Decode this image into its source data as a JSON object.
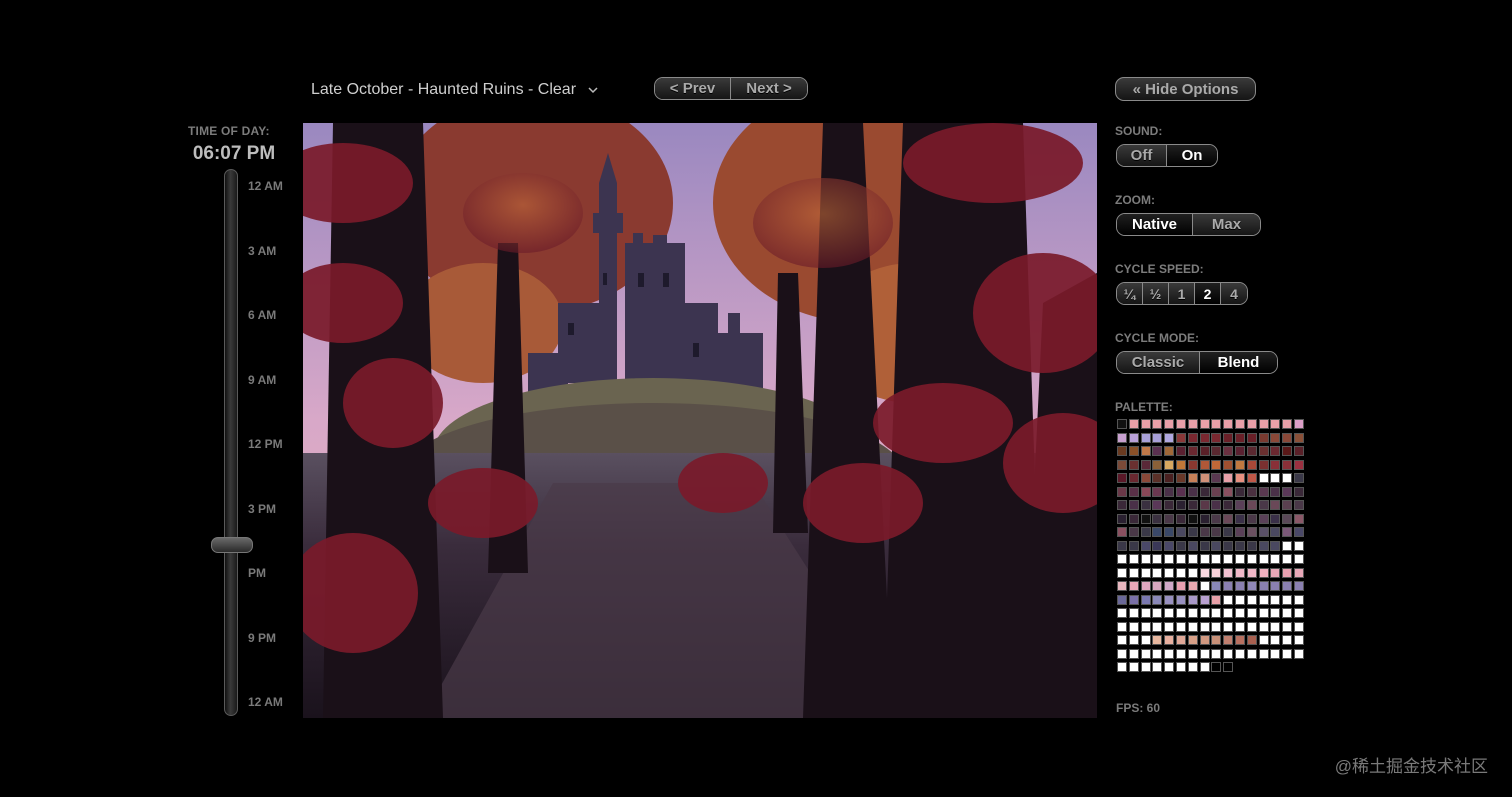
{
  "header": {
    "scene_title": "Late October - Haunted Ruins - Clear",
    "prev_label": "< Prev",
    "next_label": "Next >",
    "hide_options_label": "« Hide Options"
  },
  "time_of_day": {
    "label": "TIME OF DAY:",
    "value": "06:07 PM",
    "ticks": [
      "12 AM",
      "3 AM",
      "6 AM",
      "9 AM",
      "12 PM",
      "3 PM",
      "PM",
      "9 PM",
      "12 AM"
    ],
    "position_fraction": 0.755
  },
  "options": {
    "sound": {
      "label": "SOUND:",
      "choices": [
        "Off",
        "On"
      ],
      "selected": "On"
    },
    "zoom": {
      "label": "ZOOM:",
      "choices": [
        "Native",
        "Max"
      ],
      "selected": "Native"
    },
    "cycle_speed": {
      "label": "CYCLE SPEED:",
      "choices": [
        "¼",
        "½",
        "1",
        "2",
        "4"
      ],
      "selected": "2"
    },
    "cycle_mode": {
      "label": "CYCLE MODE:",
      "choices": [
        "Classic",
        "Blend"
      ],
      "selected": "Blend"
    },
    "palette_label": "PALETTE:",
    "fps": "FPS: 60"
  },
  "palette_colors": [
    "#111111",
    "#e8a0a8",
    "#e8a0a8",
    "#e8a0a8",
    "#e8a0a8",
    "#e8a0a8",
    "#e8a0a8",
    "#e8a0a8",
    "#e8a0a8",
    "#e8a0a8",
    "#e8a0a8",
    "#e8a0a8",
    "#e8a0a8",
    "#e8a0a8",
    "#e8a0a8",
    "#dca0c8",
    "#c8a0d0",
    "#b8a0d8",
    "#a8a0d8",
    "#a8a0d8",
    "#b0a8e0",
    "#8a3838",
    "#7a2830",
    "#7a2830",
    "#7a2830",
    "#6a2028",
    "#6a2028",
    "#6a2028",
    "#7a3a30",
    "#8a4838",
    "#8a4838",
    "#8a5038",
    "#6a3a20",
    "#8a5028",
    "#c07848",
    "#5a3050",
    "#a06838",
    "#5a2030",
    "#6a2830",
    "#5a2028",
    "#5a2830",
    "#6a3040",
    "#5a2030",
    "#5a2830",
    "#6a3030",
    "#6a2830",
    "#5a1818",
    "#5a2028",
    "#7a4a38",
    "#6a3030",
    "#5a2838",
    "#8a6038",
    "#d8a860",
    "#c07838",
    "#8a3830",
    "#b05838",
    "#c06838",
    "#a05030",
    "#c07840",
    "#a84838",
    "#7a3030",
    "#8a3038",
    "#8a3038",
    "#9a3040",
    "#5a1828",
    "#6a2830",
    "#8a4838",
    "#5a3028",
    "#4a2020",
    "#6a3828",
    "#c88058",
    "#d09078",
    "#5a3850",
    "#e8a0a8",
    "#e89080",
    "#c05848",
    "#ffffff",
    "#ffffff",
    "#ffffff",
    "#3a3848",
    "#6a3848",
    "#5a3048",
    "#8a4858",
    "#6a3850",
    "#4a3048",
    "#5a3050",
    "#4a3048",
    "#3a2838",
    "#6a4050",
    "#8a5060",
    "#3a2838",
    "#4a3040",
    "#5a3850",
    "#4a3048",
    "#5a3858",
    "#3a2838",
    "#3a2838",
    "#4a3048",
    "#3a3040",
    "#5a3858",
    "#3a2838",
    "#2a2030",
    "#3a2838",
    "#5a3848",
    "#4a3048",
    "#3a2838",
    "#5a4058",
    "#6a4858",
    "#4a3848",
    "#6a4858",
    "#5a4050",
    "#4a3848",
    "#2a2030",
    "#3a2838",
    "#111111",
    "#3a3040",
    "#4a3848",
    "#3a2838",
    "#111111",
    "#2a2030",
    "#4a3848",
    "#6a4858",
    "#3a3048",
    "#4a3848",
    "#5a4058",
    "#3a3048",
    "#5a4858",
    "#8a5868",
    "#8a5060",
    "#4a3848",
    "#3a3848",
    "#3a4868",
    "#3a4868",
    "#4a4860",
    "#3a3848",
    "#4a3848",
    "#4a3848",
    "#3a3848",
    "#5a4058",
    "#6a5060",
    "#5a5068",
    "#4a4860",
    "#7a5878",
    "#4a4868",
    "#3a3848",
    "#3a3848",
    "#4a4868",
    "#3a3858",
    "#4a4868",
    "#3a3848",
    "#4a4860",
    "#3a3848",
    "#4a4860",
    "#3a3848",
    "#3a3848",
    "#3a3848",
    "#4a4860",
    "#4a4860",
    "#ffffff",
    "#ffffff",
    "#ffffff",
    "#ffffff",
    "#ffffff",
    "#ffffff",
    "#ffffff",
    "#ffffff",
    "#ffffff",
    "#ffffff",
    "#ffffff",
    "#ffffff",
    "#ffffff",
    "#ffffff",
    "#ffffff",
    "#ffffff",
    "#ffffff",
    "#ffffff",
    "#ffffff",
    "#ffffff",
    "#ffffff",
    "#ffffff",
    "#ffffff",
    "#ffffff",
    "#ffffff",
    "#f8d8e0",
    "#f8d0d8",
    "#f0c0d0",
    "#f0b8c8",
    "#f0b8c8",
    "#f0b0c0",
    "#e8a8b8",
    "#e8a0b0",
    "#e8a8b8",
    "#e8b8c0",
    "#e8a8b8",
    "#e0a8c0",
    "#d8a8c0",
    "#d0a8c8",
    "#e8a0b0",
    "#e8a8b0",
    "#ffffff",
    "#8a88b8",
    "#8a80b0",
    "#8a80b0",
    "#9088b8",
    "#8a80b0",
    "#8a80b0",
    "#8a80b0",
    "#8a80b0",
    "#6a6898",
    "#7a70a8",
    "#7a78b0",
    "#8a88b8",
    "#9890c0",
    "#9890c0",
    "#a898c8",
    "#b8a0d0",
    "#e8a0a8",
    "#ffffff",
    "#ffffff",
    "#ffffff",
    "#ffffff",
    "#ffffff",
    "#ffffff",
    "#ffffff",
    "#ffffff",
    "#ffffff",
    "#ffffff",
    "#ffffff",
    "#ffffff",
    "#ffffff",
    "#ffffff",
    "#ffffff",
    "#ffffff",
    "#ffffff",
    "#ffffff",
    "#ffffff",
    "#ffffff",
    "#ffffff",
    "#ffffff",
    "#ffffff",
    "#ffffff",
    "#ffffff",
    "#ffffff",
    "#ffffff",
    "#ffffff",
    "#ffffff",
    "#ffffff",
    "#ffffff",
    "#ffffff",
    "#ffffff",
    "#ffffff",
    "#ffffff",
    "#ffffff",
    "#ffffff",
    "#ffffff",
    "#ffffff",
    "#ffffff",
    "#ffffff",
    "#ffffff",
    "#e8b8a0",
    "#e8b0a0",
    "#e0a898",
    "#d8a088",
    "#d09880",
    "#c89078",
    "#c08070",
    "#b87060",
    "#a86050",
    "#ffffff",
    "#ffffff",
    "#ffffff",
    "#ffffff",
    "#ffffff",
    "#ffffff",
    "#ffffff",
    "#ffffff",
    "#ffffff",
    "#ffffff",
    "#ffffff",
    "#ffffff",
    "#ffffff",
    "#ffffff",
    "#ffffff",
    "#ffffff",
    "#ffffff",
    "#ffffff",
    "#ffffff",
    "#ffffff",
    "#ffffff",
    "#ffffff",
    "#ffffff",
    "#ffffff",
    "#ffffff",
    "#ffffff",
    "#ffffff",
    "#ffffff",
    "#000000",
    "#000000"
  ],
  "watermark": "@稀土掘金技术社区",
  "colors": {
    "background": "#000000",
    "control_border": "#8a8a8a",
    "label_gray": "#7c7c7c",
    "sky_top": "#b098c8",
    "sky_bottom": "#e8b0b8",
    "leaf_red": "#8a2030"
  }
}
